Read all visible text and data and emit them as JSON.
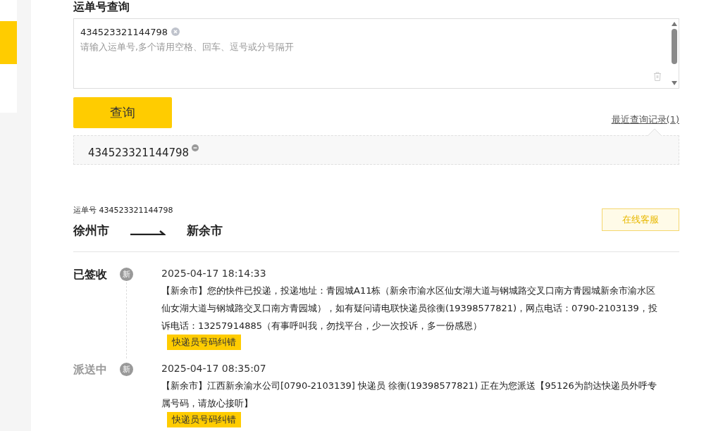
{
  "heading": "运单号查询",
  "query": {
    "tokens": [
      "434523321144798"
    ],
    "placeholder": "请输入运单号,多个请用空格、回车、逗号或分号隔开"
  },
  "search_button": "查询",
  "history": {
    "link": "最近查询记录(1)",
    "items": [
      "434523321144798"
    ]
  },
  "waybill": {
    "label": "运单号 434523321144798",
    "origin": "徐州市",
    "destination": "新余市",
    "service_button": "在线客服"
  },
  "events": [
    {
      "status": "已签收",
      "latest": true,
      "badge": "新",
      "time": "2025-04-17 18:14:33",
      "text": "【新余市】您的快件已投递，投递地址：青园城A11栋（新余市渝水区仙女湖大道与钢城路交叉口南方青园城新余市渝水区仙女湖大道与钢城路交叉口南方青园城），如有疑问请电联快递员徐衡(19398577821)，网点电话：0790-2103139，投诉电话：13257914885（有事呼叫我，勿找平台，少一次投诉，多一份感恩）",
      "tag": "快递员号码纠错"
    },
    {
      "status": "派送中",
      "latest": false,
      "badge": "新",
      "time": "2025-04-17 08:35:07",
      "text": "【新余市】江西新余渝水公司[0790-2103139] 快递员 徐衡(19398577821) 正在为您派送【95126为韵达快递员外呼专属号码，请放心接听】",
      "tag": "快递员号码纠错"
    }
  ]
}
